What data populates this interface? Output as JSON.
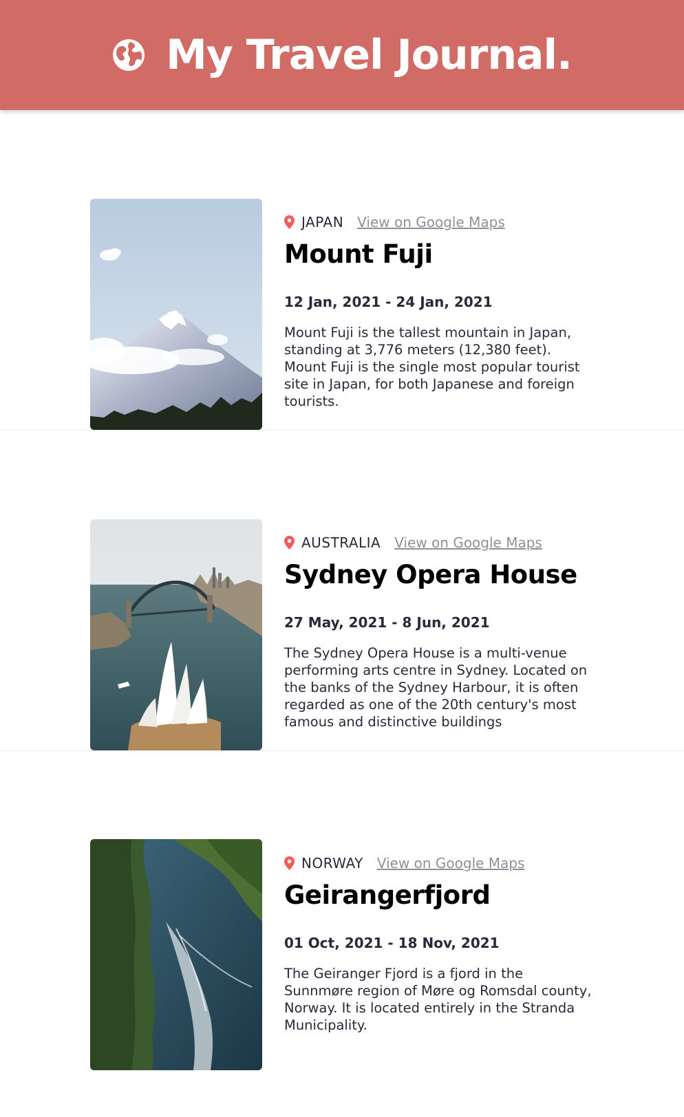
{
  "header": {
    "title": "My Travel Journal.",
    "icon": "globe-icon",
    "background_color": "#d06b66"
  },
  "entries": [
    {
      "country": "JAPAN",
      "maps_link": "View on Google Maps",
      "place": "Mount Fuji",
      "dates": "12 Jan, 2021 - 24 Jan, 2021",
      "description": "Mount Fuji is the tallest mountain in Japan, standing at 3,776 meters (12,380 feet). Mount Fuji is the single most popular tourist site in Japan, for both Japanese and foreign tourists.",
      "image": "mount-fuji-photo"
    },
    {
      "country": "AUSTRALIA",
      "maps_link": "View on Google Maps",
      "place": "Sydney Opera House",
      "dates": "27 May, 2021 - 8 Jun, 2021",
      "description": "The Sydney Opera House is a multi-venue performing arts centre in Sydney. Located on the banks of the Sydney Harbour, it is often regarded as one of the 20th century's most famous and distinctive buildings",
      "image": "sydney-opera-house-photo"
    },
    {
      "country": "NORWAY",
      "maps_link": "View on Google Maps",
      "place": "Geirangerfjord",
      "dates": "01 Oct, 2021 - 18 Nov, 2021",
      "description": "The Geiranger Fjord is a fjord in the Sunnmøre region of Møre og Romsdal county, Norway. It is located entirely in the Stranda Municipality.",
      "image": "geirangerfjord-photo"
    }
  ],
  "colors": {
    "accent": "#d06b66",
    "pin": "#f55a5a",
    "link": "#918e9b",
    "text": "#2b283a"
  }
}
